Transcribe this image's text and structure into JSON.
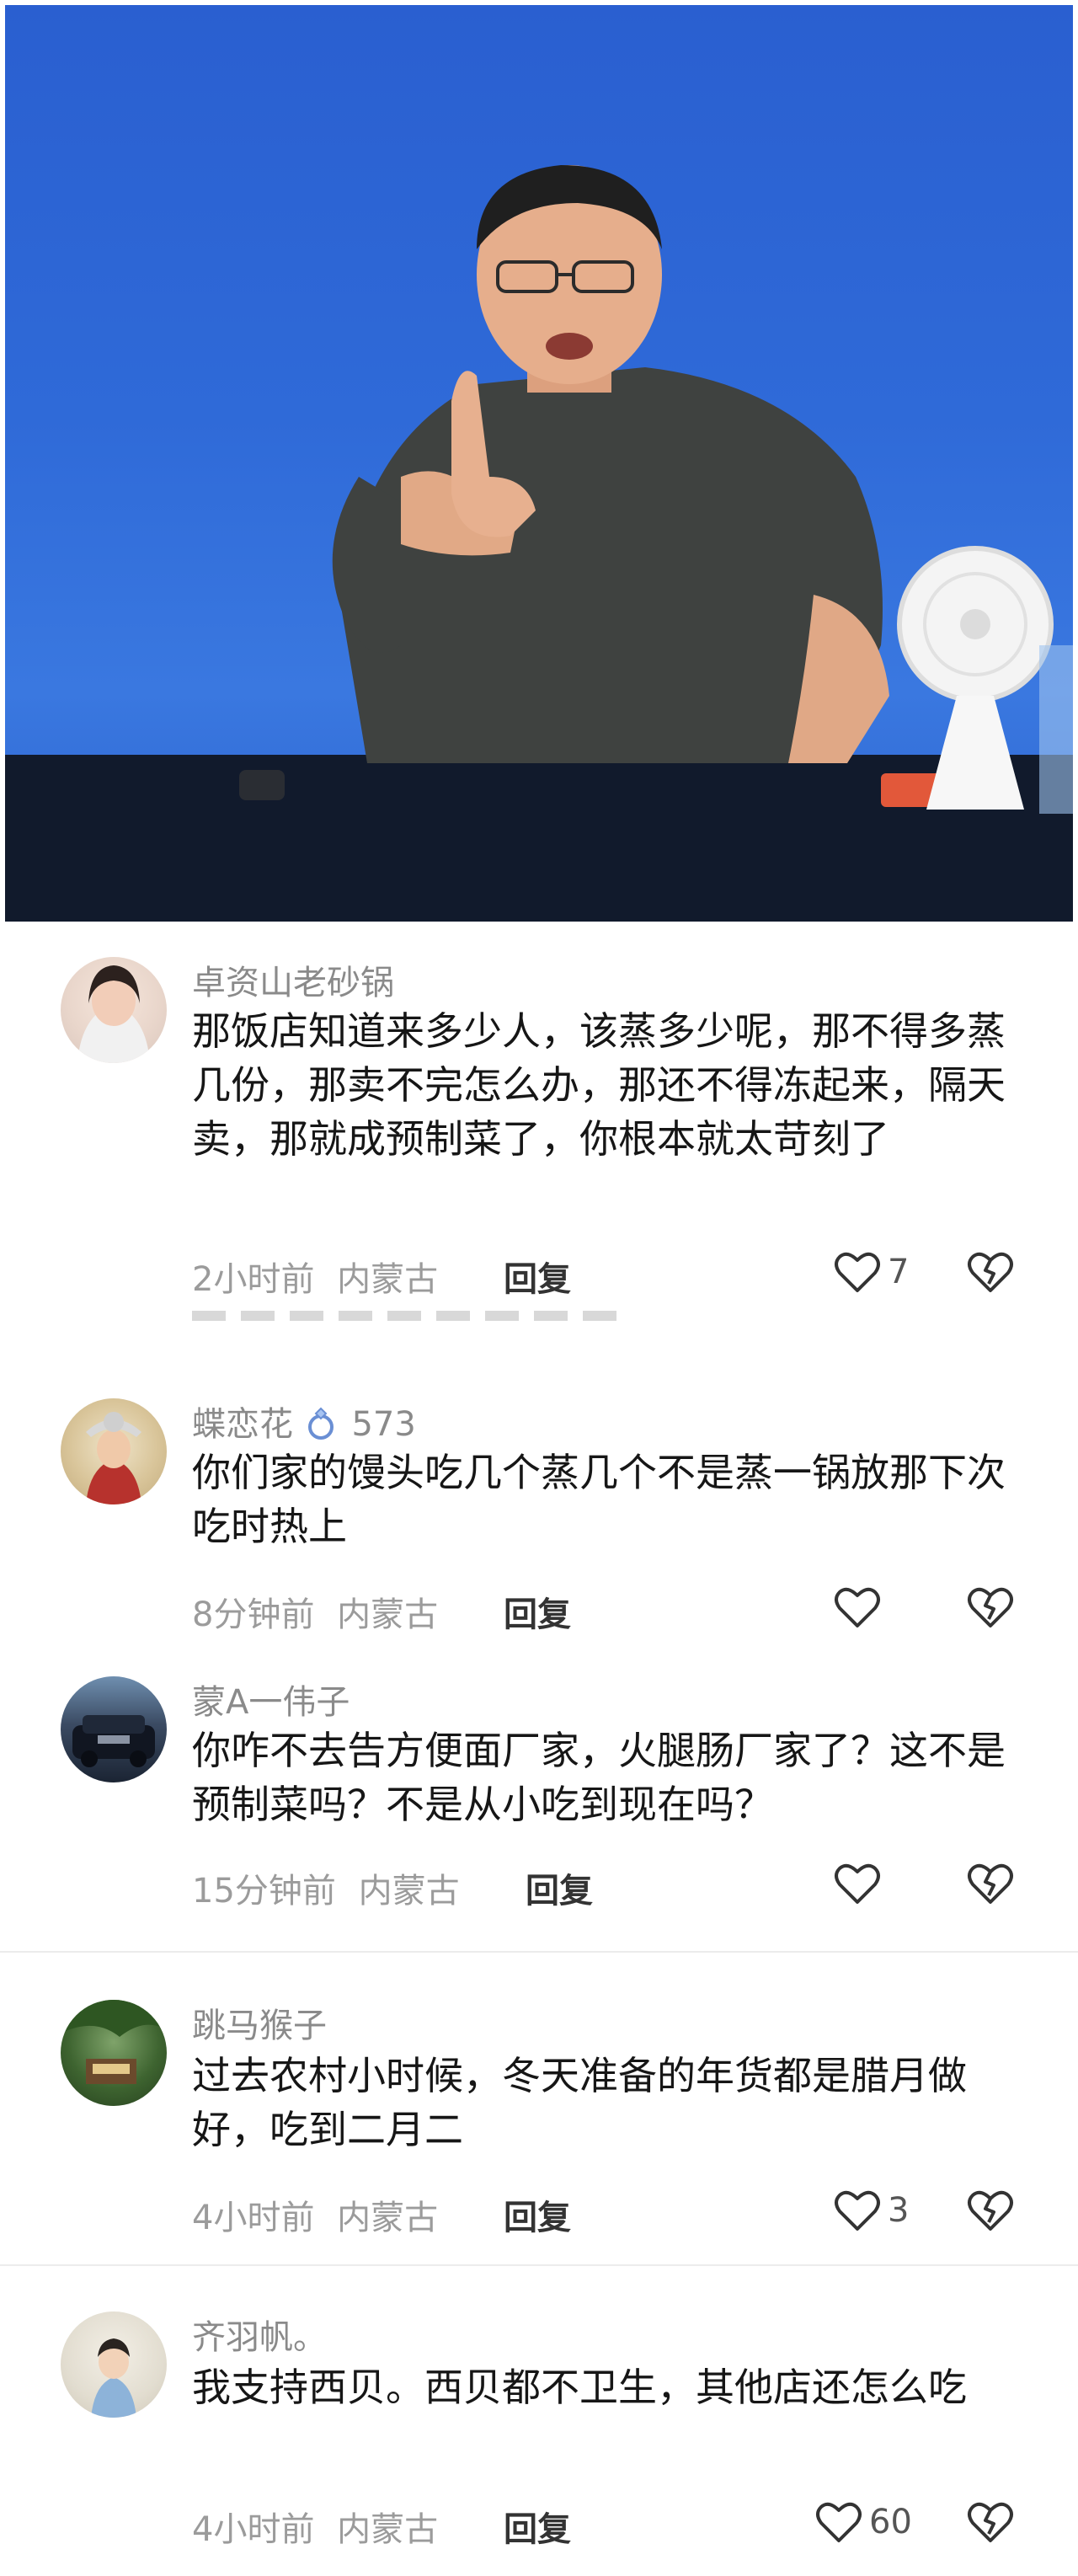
{
  "video": {
    "alt": ""
  },
  "comments": [
    {
      "username": "卓资山老砂锅",
      "text": "那饭店知道来多少人，该蒸多少呢，那不得多蒸几份，那卖不完怎么办，那还不得冻起来，隔天卖，那就成预制菜了，你根本就太苛刻了",
      "time": "2小时前",
      "location": "内蒙古",
      "reply_label": "回复",
      "likes": "7"
    },
    {
      "username": "蝶恋花",
      "badge_icon": "ring-icon",
      "badge_count": "573",
      "text": "你们家的馒头吃几个蒸几个不是蒸一锅放那下次吃时热上",
      "time": "8分钟前",
      "location": "内蒙古",
      "reply_label": "回复",
      "likes": ""
    },
    {
      "username": "蒙A一伟子",
      "text": "你咋不去告方便面厂家，火腿肠厂家了？这不是预制菜吗？不是从小吃到现在吗？",
      "time": "15分钟前",
      "location": "内蒙古",
      "reply_label": "回复",
      "likes": ""
    },
    {
      "username": "跳马猴子",
      "text": "过去农村小时候，冬天准备的年货都是腊月做好，吃到二月二",
      "time": "4小时前",
      "location": "内蒙古",
      "reply_label": "回复",
      "likes": "3"
    },
    {
      "username": "齐羽帆。",
      "text": "我支持西贝。西贝都不卫生，其他店还怎么吃",
      "time": "4小时前",
      "location": "内蒙古",
      "reply_label": "回复",
      "likes": "60"
    }
  ],
  "colors": {
    "video_bg": "#2f6ad8",
    "text_primary": "#161616",
    "text_secondary": "#8a8a8a"
  }
}
